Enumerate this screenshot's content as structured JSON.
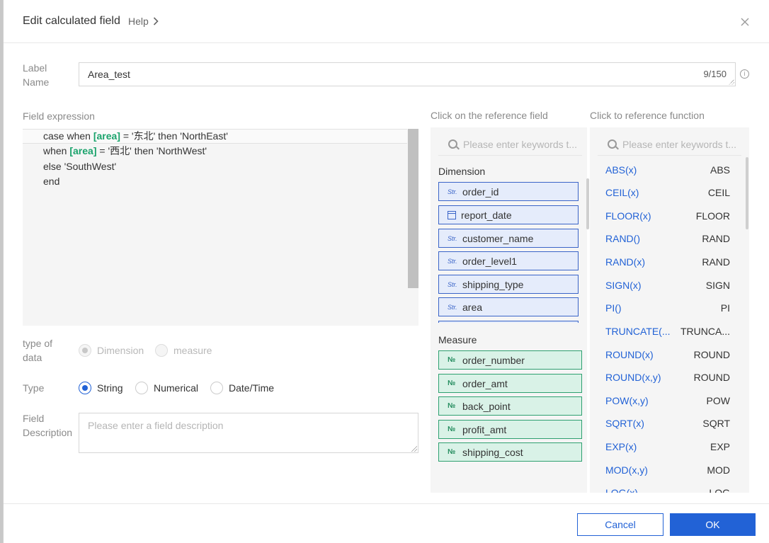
{
  "dialog": {
    "title": "Edit calculated field",
    "help_label": "Help",
    "close_glyph": "×"
  },
  "label_name": {
    "label_line1": "Label",
    "label_line2": "Name",
    "value": "Area_test",
    "counter": "9/150"
  },
  "expression": {
    "label": "Field expression",
    "lines": [
      {
        "pre": "case when ",
        "field": "[area]",
        "post": " = '东北' then 'NorthEast'"
      },
      {
        "pre": "when ",
        "field": "[area]",
        "post": " = '西北' then 'NorthWest'"
      },
      {
        "pre": "else 'SouthWest'",
        "field": "",
        "post": ""
      },
      {
        "pre": "end",
        "field": "",
        "post": ""
      }
    ]
  },
  "data_type": {
    "label_line1": "type of",
    "label_line2": "data",
    "options": [
      "Dimension",
      "measure"
    ],
    "selected": "Dimension"
  },
  "type": {
    "label": "Type",
    "options": [
      "String",
      "Numerical",
      "Date/Time"
    ],
    "selected": "String"
  },
  "description": {
    "label_line1": "Field",
    "label_line2": "Description",
    "placeholder": "Please enter a field description"
  },
  "reference_field": {
    "header": "Click on the reference field",
    "search_placeholder": "Please enter keywords t...",
    "dimension_title": "Dimension",
    "dimensions": [
      {
        "tag": "Str.",
        "name": "order_id"
      },
      {
        "tag": "date",
        "name": "report_date"
      },
      {
        "tag": "Str.",
        "name": "customer_name"
      },
      {
        "tag": "Str.",
        "name": "order_level1"
      },
      {
        "tag": "Str.",
        "name": "shipping_type"
      },
      {
        "tag": "Str.",
        "name": "area"
      }
    ],
    "measure_title": "Measure",
    "measures": [
      {
        "tag": "№",
        "name": "order_number"
      },
      {
        "tag": "№",
        "name": "order_amt"
      },
      {
        "tag": "№",
        "name": "back_point"
      },
      {
        "tag": "№",
        "name": "profit_amt"
      },
      {
        "tag": "№",
        "name": "shipping_cost"
      }
    ]
  },
  "reference_function": {
    "header": "Click to reference function",
    "search_placeholder": "Please enter keywords t...",
    "functions": [
      {
        "name": "ABS(x)",
        "ref": "ABS"
      },
      {
        "name": "CEIL(x)",
        "ref": "CEIL"
      },
      {
        "name": "FLOOR(x)",
        "ref": "FLOOR"
      },
      {
        "name": "RAND()",
        "ref": "RAND"
      },
      {
        "name": "RAND(x)",
        "ref": "RAND"
      },
      {
        "name": "SIGN(x)",
        "ref": "SIGN"
      },
      {
        "name": "PI()",
        "ref": "PI"
      },
      {
        "name": "TRUNCATE(...",
        "ref": "TRUNCA..."
      },
      {
        "name": "ROUND(x)",
        "ref": "ROUND"
      },
      {
        "name": "ROUND(x,y)",
        "ref": "ROUND"
      },
      {
        "name": "POW(x,y)",
        "ref": "POW"
      },
      {
        "name": "SQRT(x)",
        "ref": "SQRT"
      },
      {
        "name": "EXP(x)",
        "ref": "EXP"
      },
      {
        "name": "MOD(x,y)",
        "ref": "MOD"
      },
      {
        "name": "LOG(x)",
        "ref": "LOG"
      }
    ]
  },
  "footer": {
    "cancel_label": "Cancel",
    "ok_label": "OK"
  },
  "colors": {
    "primary": "#2262d6",
    "dimension_bg": "#e5ecfb",
    "measure_bg": "#d9f2e7",
    "field_highlight": "#1aa36c"
  }
}
